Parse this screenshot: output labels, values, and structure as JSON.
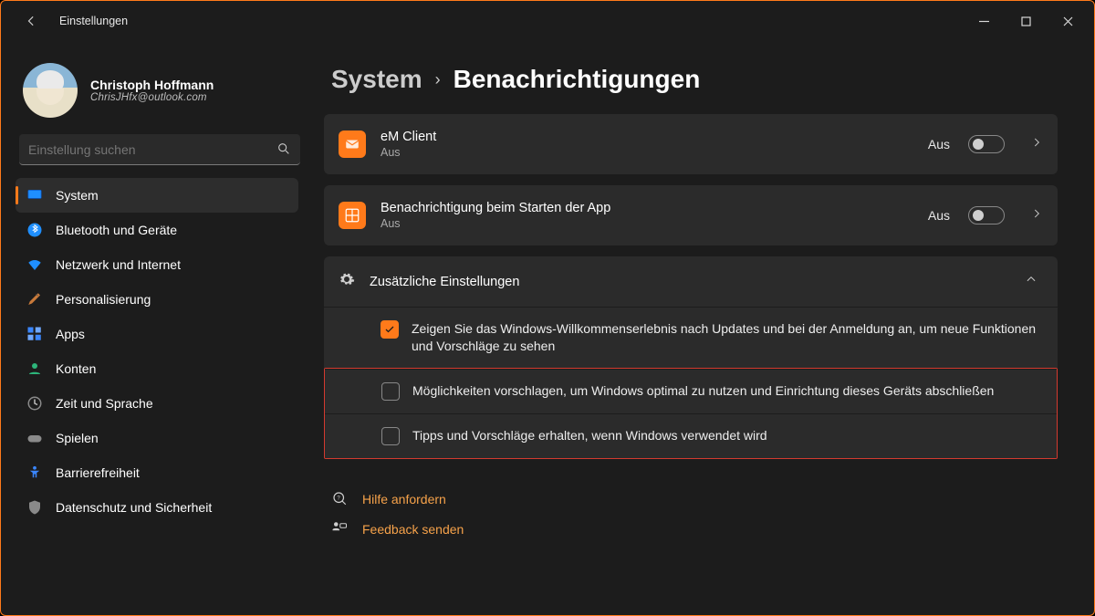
{
  "app_title": "Einstellungen",
  "profile": {
    "name": "Christoph Hoffmann",
    "email": "ChrisJHfx@outlook.com"
  },
  "search": {
    "placeholder": "Einstellung suchen"
  },
  "sidebar": {
    "items": [
      {
        "label": "System"
      },
      {
        "label": "Bluetooth und Geräte"
      },
      {
        "label": "Netzwerk und Internet"
      },
      {
        "label": "Personalisierung"
      },
      {
        "label": "Apps"
      },
      {
        "label": "Konten"
      },
      {
        "label": "Zeit und Sprache"
      },
      {
        "label": "Spielen"
      },
      {
        "label": "Barrierefreiheit"
      },
      {
        "label": "Datenschutz und Sicherheit"
      }
    ]
  },
  "breadcrumb": {
    "parent": "System",
    "current": "Benachrichtigungen"
  },
  "cards": {
    "emclient": {
      "title": "eM Client",
      "sub": "Aus",
      "state": "Aus"
    },
    "appstart": {
      "title": "Benachrichtigung beim Starten der App",
      "sub": "Aus",
      "state": "Aus"
    }
  },
  "additional": {
    "title": "Zusätzliche Einstellungen",
    "opts": [
      {
        "label": "Zeigen Sie das Windows-Willkommenserlebnis nach Updates und bei der Anmeldung an, um neue Funktionen und Vorschläge zu sehen",
        "checked": true
      },
      {
        "label": "Möglichkeiten vorschlagen, um Windows optimal zu nutzen und Einrichtung dieses Geräts abschließen",
        "checked": false
      },
      {
        "label": "Tipps und Vorschläge erhalten, wenn Windows verwendet wird",
        "checked": false
      }
    ]
  },
  "help": {
    "request": "Hilfe anfordern",
    "feedback": "Feedback senden"
  }
}
